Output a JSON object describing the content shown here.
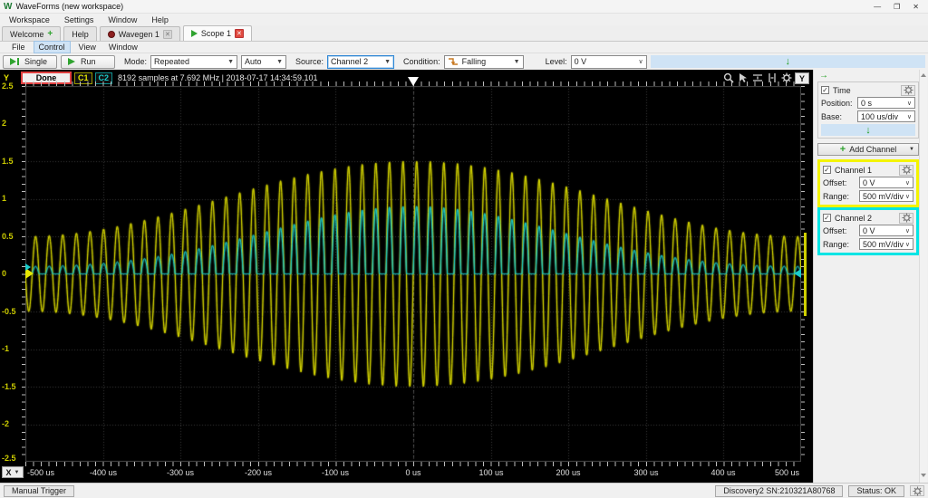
{
  "window": {
    "logo": "W",
    "title": "WaveForms (new workspace)",
    "minimize": "—",
    "maximize": "❐",
    "close": "✕"
  },
  "menubar": {
    "items": [
      "Workspace",
      "Settings",
      "Window",
      "Help"
    ]
  },
  "tabs": {
    "welcome": "Welcome",
    "help": "Help",
    "wavegen": "Wavegen 1",
    "scope": "Scope 1"
  },
  "scope_menu": {
    "items": [
      "File",
      "Control",
      "View",
      "Window"
    ]
  },
  "toolbar": {
    "single": "Single",
    "run": "Run",
    "mode_label": "Mode:",
    "mode": "Repeated",
    "auto": "Auto",
    "source_label": "Source:",
    "source": "Channel 2",
    "condition_label": "Condition:",
    "condition": "Falling",
    "level_label": "Level:",
    "level": "0 V"
  },
  "scope_header": {
    "y_button": "Y",
    "done": "Done",
    "c1": "C1",
    "c2": "C2",
    "info": "8192 samples at 7.692 MHz | 2018-07-17 14:34:59.101"
  },
  "plot": {
    "x_button": "X",
    "y_ticks": [
      "2.5",
      "2",
      "1.5",
      "1",
      "0.5",
      "0",
      "-0.5",
      "-1",
      "-1.5",
      "-2",
      "-2.5"
    ],
    "x_ticks": [
      "-500 us",
      "-400 us",
      "-300 us",
      "-200 us",
      "-100 us",
      "0 us",
      "100 us",
      "200 us",
      "300 us",
      "400 us",
      "500 us"
    ]
  },
  "right_panel": {
    "time": {
      "label": "Time",
      "position_label": "Position:",
      "position": "0 s",
      "base_label": "Base:",
      "base": "100 us/div"
    },
    "add_channel": "Add Channel",
    "channel1": {
      "label": "Channel 1",
      "offset_label": "Offset:",
      "offset": "0 V",
      "range_label": "Range:",
      "range": "500 mV/div"
    },
    "channel2": {
      "label": "Channel 2",
      "offset_label": "Offset:",
      "offset": "0 V",
      "range_label": "Range:",
      "range": "500 mV/div"
    }
  },
  "status_bar": {
    "manual_trigger": "Manual Trigger",
    "device": "Discovery2 SN:210321A80768",
    "status": "Status: OK"
  },
  "waveform": {
    "type": "oscilloscope-traces",
    "x_range_us": [
      -500,
      500
    ],
    "y_range_V": [
      -2.5,
      2.5
    ],
    "x_divisions": 10,
    "y_divisions": 10,
    "carrier_cycles": 57,
    "bg": "#000000",
    "grid_color": "#3a3a3a",
    "trigger_line_color": "rgba(255,255,255,0.28)",
    "channels": [
      {
        "name": "Channel 1",
        "color": "#dede00",
        "kind": "am_sine",
        "envelope_V": {
          "min_at_edges": 0.5,
          "max_at_center": 1.5
        }
      },
      {
        "name": "Channel 2",
        "color": "#19cccc",
        "kind": "half_rectified_am",
        "peak_at_center_V": 0.9,
        "peak_at_edges_V": 0.1
      }
    ]
  }
}
